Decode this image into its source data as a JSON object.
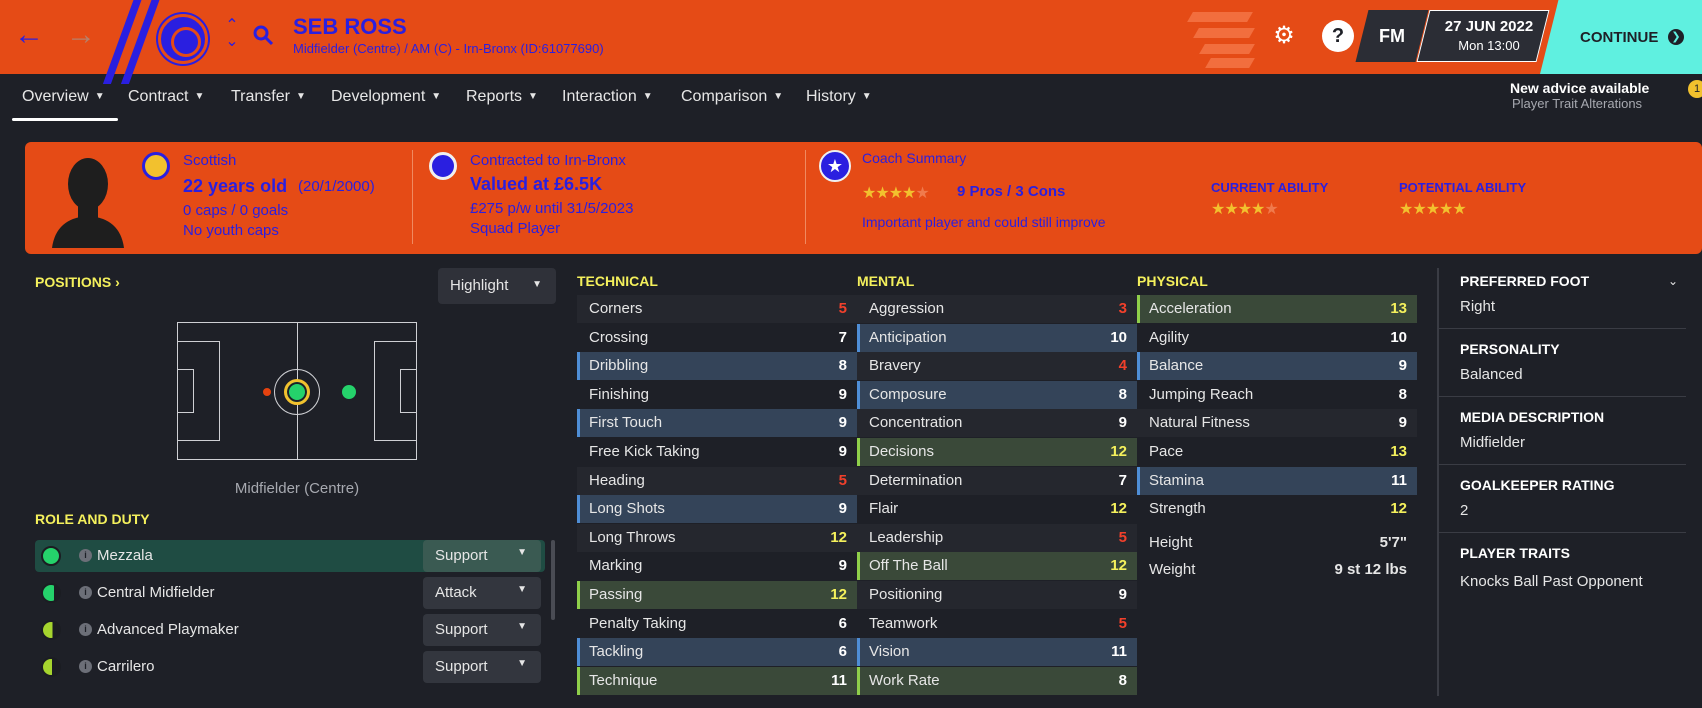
{
  "header": {
    "back_icon": "arrow-left-icon",
    "forward_icon": "arrow-right-icon",
    "player_name": "SEB ROSS",
    "player_subtitle": "Midfielder (Centre) / AM (C) - Irn-Bronx (ID:61077690)",
    "date": "27 JUN 2022",
    "time": "Mon 13:00",
    "continue_label": "CONTINUE",
    "fm_label": "FM",
    "help_label": "?",
    "colors": {
      "bar": "#e54b16",
      "accent": "#2a1fe0",
      "continue": "#5ff0e0"
    }
  },
  "tabs": [
    {
      "label": "Overview",
      "active": true
    },
    {
      "label": "Contract"
    },
    {
      "label": "Transfer"
    },
    {
      "label": "Development"
    },
    {
      "label": "Reports"
    },
    {
      "label": "Interaction"
    },
    {
      "label": "Comparison"
    },
    {
      "label": "History"
    }
  ],
  "advice": {
    "title": "New advice available",
    "subtitle": "Player Trait Alterations",
    "count": "1"
  },
  "banner": {
    "nationality": "Scottish",
    "age": "22 years old",
    "dob": "(20/1/2000)",
    "caps": "0 caps / 0 goals",
    "youth_caps": "No youth caps",
    "contracted": "Contracted to Irn-Bronx",
    "value": "Valued at £6.5K",
    "wage": "£275 p/w until 31/5/2023",
    "squad_status": "Squad Player",
    "coach_summary_label": "Coach Summary",
    "coach_stars": 3.5,
    "pros_cons": "9 Pros / 3 Cons",
    "coach_note": "Important player and could still improve",
    "current_ability_label": "CURRENT ABILITY",
    "current_ability_stars": 3.5,
    "potential_ability_label": "POTENTIAL ABILITY",
    "potential_ability_stars": 4.5
  },
  "positions": {
    "title": "POSITIONS",
    "highlight_label": "Highlight",
    "position_label": "Midfielder (Centre)"
  },
  "roles": {
    "title": "ROLE AND DUTY",
    "items": [
      {
        "name": "Mezzala",
        "duty": "Support",
        "rating": 1.0,
        "selected": true
      },
      {
        "name": "Central Midfielder",
        "duty": "Attack",
        "rating": 0.6
      },
      {
        "name": "Advanced Playmaker",
        "duty": "Support",
        "rating": 0.5
      },
      {
        "name": "Carrilero",
        "duty": "Support",
        "rating": 0.45
      }
    ]
  },
  "technical": {
    "title": "TECHNICAL",
    "attrs": [
      {
        "name": "Corners",
        "value": "5"
      },
      {
        "name": "Crossing",
        "value": "7"
      },
      {
        "name": "Dribbling",
        "value": "8",
        "hl": "blue"
      },
      {
        "name": "Finishing",
        "value": "9"
      },
      {
        "name": "First Touch",
        "value": "9",
        "hl": "blue"
      },
      {
        "name": "Free Kick Taking",
        "value": "9"
      },
      {
        "name": "Heading",
        "value": "5"
      },
      {
        "name": "Long Shots",
        "value": "9",
        "hl": "blue"
      },
      {
        "name": "Long Throws",
        "value": "12"
      },
      {
        "name": "Marking",
        "value": "9"
      },
      {
        "name": "Passing",
        "value": "12",
        "hl": "green"
      },
      {
        "name": "Penalty Taking",
        "value": "6"
      },
      {
        "name": "Tackling",
        "value": "6",
        "hl": "blue"
      },
      {
        "name": "Technique",
        "value": "11",
        "hl": "green"
      }
    ]
  },
  "mental": {
    "title": "MENTAL",
    "attrs": [
      {
        "name": "Aggression",
        "value": "3"
      },
      {
        "name": "Anticipation",
        "value": "10",
        "hl": "blue"
      },
      {
        "name": "Bravery",
        "value": "4"
      },
      {
        "name": "Composure",
        "value": "8",
        "hl": "blue"
      },
      {
        "name": "Concentration",
        "value": "9"
      },
      {
        "name": "Decisions",
        "value": "12",
        "hl": "green"
      },
      {
        "name": "Determination",
        "value": "7"
      },
      {
        "name": "Flair",
        "value": "12"
      },
      {
        "name": "Leadership",
        "value": "5"
      },
      {
        "name": "Off The Ball",
        "value": "12",
        "hl": "green"
      },
      {
        "name": "Positioning",
        "value": "9"
      },
      {
        "name": "Teamwork",
        "value": "5"
      },
      {
        "name": "Vision",
        "value": "11",
        "hl": "blue"
      },
      {
        "name": "Work Rate",
        "value": "8",
        "hl": "green"
      }
    ]
  },
  "physical": {
    "title": "PHYSICAL",
    "attrs": [
      {
        "name": "Acceleration",
        "value": "13",
        "hl": "green"
      },
      {
        "name": "Agility",
        "value": "10"
      },
      {
        "name": "Balance",
        "value": "9",
        "hl": "blue"
      },
      {
        "name": "Jumping Reach",
        "value": "8"
      },
      {
        "name": "Natural Fitness",
        "value": "9"
      },
      {
        "name": "Pace",
        "value": "13"
      },
      {
        "name": "Stamina",
        "value": "11",
        "hl": "blue"
      },
      {
        "name": "Strength",
        "value": "12"
      }
    ],
    "height_label": "Height",
    "height": "5'7\"",
    "weight_label": "Weight",
    "weight": "9 st 12 lbs"
  },
  "info": {
    "preferred_foot_label": "PREFERRED FOOT",
    "preferred_foot": "Right",
    "personality_label": "PERSONALITY",
    "personality": "Balanced",
    "media_label": "MEDIA DESCRIPTION",
    "media": "Midfielder",
    "gk_label": "GOALKEEPER RATING",
    "gk": "2",
    "traits_label": "PLAYER TRAITS",
    "traits": "Knocks Ball Past Opponent"
  }
}
